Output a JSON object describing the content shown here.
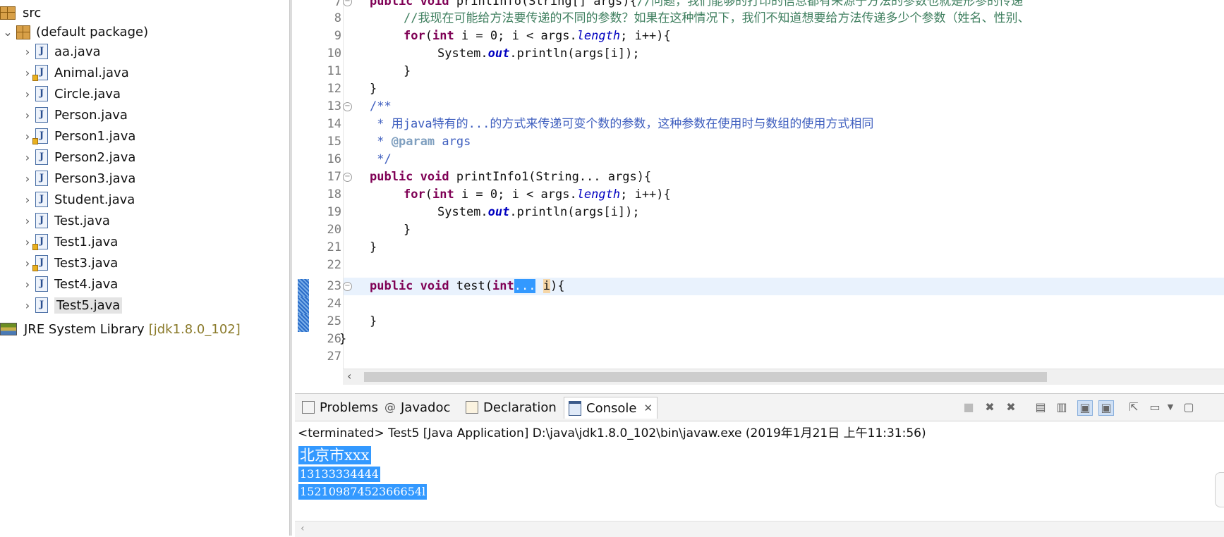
{
  "explorer": {
    "src_label": "src",
    "package_label": "(default package)",
    "files": [
      "aa.java",
      "Animal.java",
      "Circle.java",
      "Person.java",
      "Person1.java",
      "Person2.java",
      "Person3.java",
      "Student.java",
      "Test.java",
      "Test1.java",
      "Test3.java",
      "Test4.java",
      "Test5.java"
    ],
    "jre_label": "JRE System Library",
    "jre_version": "[jdk1.8.0_102]"
  },
  "editor": {
    "line_numbers": [
      "7",
      "8",
      "9",
      "10",
      "11",
      "12",
      "13",
      "14",
      "15",
      "16",
      "17",
      "18",
      "19",
      "20",
      "21",
      "22",
      "23",
      "24",
      "25",
      "26",
      "27"
    ],
    "l7_kw": "public void ",
    "l7_code": "printInfo(String[] args){",
    "l7_comment": "//问题，我们能够的打印的信息都有来源于方法的参数也就是形参的传递",
    "l8_comment": "//我现在可能给方法要传递的不同的参数？如果在这种情况下，我们不知道想要给方法传递多少个参数（姓名、性别、",
    "l9_kw_for": "for",
    "l9_open": "(",
    "l9_kw_int": "int",
    "l9_mid": " i = 0; i < args.",
    "l9_field": "length",
    "l9_end": "; i++){",
    "l10_pre": "System.",
    "l10_field": "out",
    "l10_post": ".println(args[i]);",
    "l11": "}",
    "l12": "}",
    "l13": "/**",
    "l14": " * 用java特有的...的方式来传递可变个数的参数，这种参数在使用时与数组的使用方式相同",
    "l15_star": " * ",
    "l15_tag": "@param",
    "l15_rest": " args",
    "l16": " */",
    "l17_kw": "public void ",
    "l17_code": "printInfo1(String... args){",
    "l18_kw_for": "for",
    "l18_open": "(",
    "l18_kw_int": "int",
    "l18_mid": " i = 0; i < args.",
    "l18_field": "length",
    "l18_end": "; i++){",
    "l19_pre": "System.",
    "l19_field": "out",
    "l19_post": ".println(args[i]);",
    "l20": "}",
    "l21": "}",
    "l23_kw": "public void ",
    "l23_name": "test(",
    "l23_int": "int",
    "l23_sel": "...",
    "l23_sp": " ",
    "l23_i": "i",
    "l23_end": "){",
    "l25": "}",
    "l26": "}"
  },
  "panel": {
    "tabs": [
      {
        "label": "Problems",
        "icon": "problems-icon"
      },
      {
        "label": "Javadoc",
        "icon": "at-icon"
      },
      {
        "label": "Declaration",
        "icon": "declaration-icon"
      },
      {
        "label": "Console",
        "icon": "console-icon"
      }
    ],
    "terminated_line": "<terminated> Test5 [Java Application] D:\\java\\jdk1.8.0_102\\bin\\javaw.exe (2019年1月21日 上午11:31:56)",
    "output": [
      "北京市xxx",
      "13133334444",
      "15210987452366654l"
    ]
  },
  "colors": {
    "keyword": "#7f0055",
    "comment": "#3f7f5f",
    "javadoc": "#3f5fbf",
    "selection": "#3399ff",
    "current_line": "#e9f2fd"
  }
}
